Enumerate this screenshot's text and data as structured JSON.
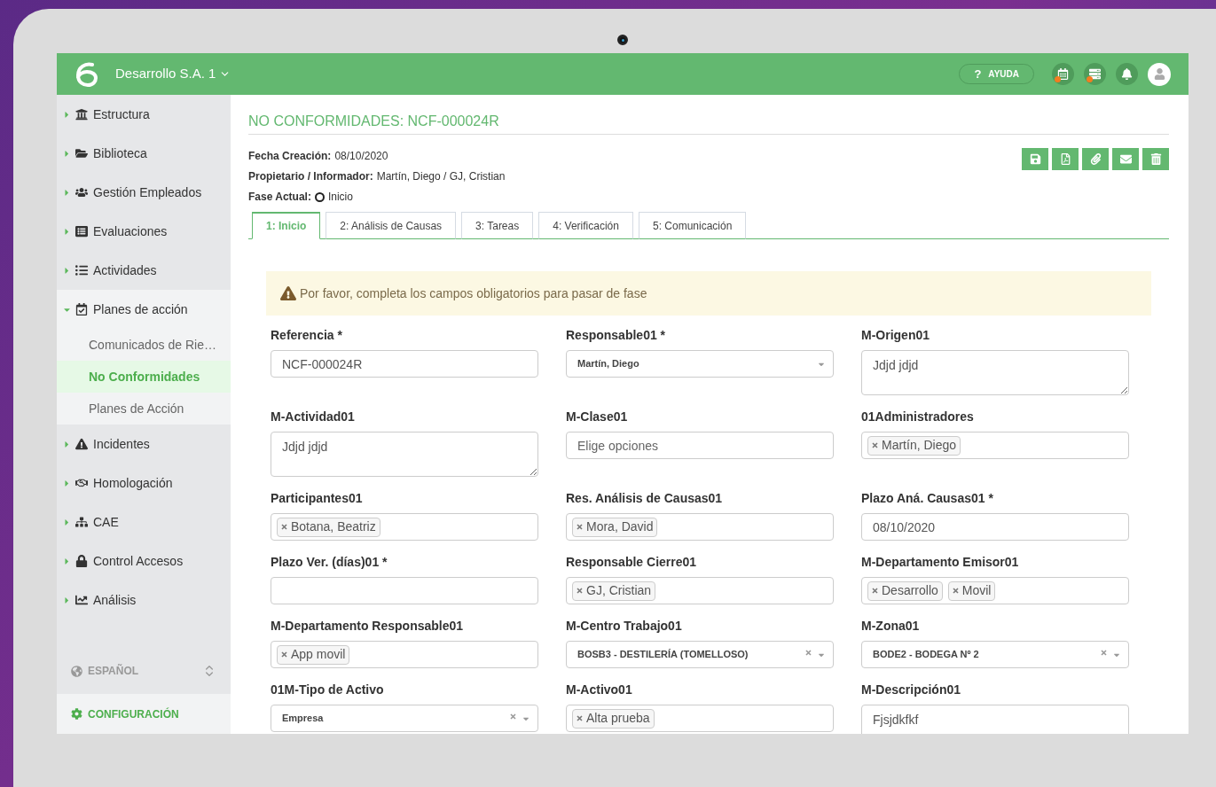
{
  "header": {
    "company": "Desarrollo S.A. 1",
    "help": "?",
    "help_label": "AYUDA",
    "icons": [
      {
        "alert": true
      },
      {
        "alert": true
      },
      {
        "alert": false
      }
    ]
  },
  "sidebar": {
    "items": [
      {
        "label": "Estructura",
        "expanded": false
      },
      {
        "label": "Biblioteca",
        "expanded": false
      },
      {
        "label": "Gestión Empleados",
        "expanded": false
      },
      {
        "label": "Evaluaciones",
        "expanded": false
      },
      {
        "label": "Actividades",
        "expanded": false
      },
      {
        "label": "Planes de acción",
        "expanded": true,
        "children": [
          {
            "label": "Comunicados de Rie…",
            "selected": false
          },
          {
            "label": "No Conformidades",
            "selected": true
          },
          {
            "label": "Planes de Acción",
            "selected": false
          }
        ]
      },
      {
        "label": "Incidentes",
        "expanded": false
      },
      {
        "label": "Homologación",
        "expanded": false
      },
      {
        "label": "CAE",
        "expanded": false
      },
      {
        "label": "Control Accesos",
        "expanded": false
      },
      {
        "label": "Análisis",
        "expanded": false
      }
    ],
    "language": "ESPAÑOL",
    "settings": "CONFIGURACIÓN"
  },
  "page": {
    "title": "NO CONFORMIDADES: NCF-000024R",
    "meta": [
      {
        "label": "Fecha Creación:",
        "value": "08/10/2020",
        "kind": "text"
      },
      {
        "label": "Propietario / Informador:",
        "value": "Martín, Diego / GJ, Cristian",
        "kind": "text"
      },
      {
        "label": "Fase Actual:",
        "value": "Inicio",
        "kind": "phase"
      }
    ],
    "tabs": [
      {
        "label": "1: Inicio",
        "selected": true
      },
      {
        "label": "2: Análisis de Causas",
        "selected": false
      },
      {
        "label": "3: Tareas",
        "selected": false
      },
      {
        "label": "4: Verificación",
        "selected": false
      },
      {
        "label": "5: Comunicación",
        "selected": false
      }
    ],
    "alert": "Por favor, completa los campos obligatorios para pasar de fase",
    "fields": [
      {
        "label": "Referencia *",
        "kind": "text",
        "value": "NCF-000024R"
      },
      {
        "label": "Responsable01 *",
        "kind": "select",
        "value": "Martín, Diego",
        "clearable": false
      },
      {
        "label": "M-Origen01",
        "kind": "textarea",
        "value": "Jdjd jdjd"
      },
      {
        "label": "M-Actividad01",
        "kind": "textarea",
        "value": "Jdjd jdjd"
      },
      {
        "label": "M-Clase01",
        "kind": "text",
        "placeholder": "Elige opciones"
      },
      {
        "label": "01Administradores",
        "kind": "tags",
        "tags": [
          "Martín, Diego"
        ]
      },
      {
        "label": "Participantes01",
        "kind": "tags",
        "tags": [
          "Botana, Beatriz"
        ]
      },
      {
        "label": "Res. Análisis de Causas01",
        "kind": "tags",
        "tags": [
          "Mora, David"
        ]
      },
      {
        "label": "Plazo Aná. Causas01 *",
        "kind": "text",
        "value": "08/10/2020"
      },
      {
        "label": "Plazo Ver. (días)01 *",
        "kind": "text"
      },
      {
        "label": "Responsable Cierre01",
        "kind": "tags",
        "tags": [
          "GJ, Cristian"
        ]
      },
      {
        "label": "M-Departamento Emisor01",
        "kind": "tags",
        "tags": [
          "Desarrollo",
          "Movil"
        ]
      },
      {
        "label": "M-Departamento Responsable01",
        "kind": "tags",
        "tags": [
          "App movil"
        ]
      },
      {
        "label": "M-Centro Trabajo01",
        "kind": "select",
        "value": "BOSB3 - DESTILERÍA (TOMELLOSO)",
        "clearable": true
      },
      {
        "label": "M-Zona01",
        "kind": "select",
        "value": "BODE2 - BODEGA Nº 2",
        "clearable": true
      },
      {
        "label": "01M-Tipo de Activo",
        "kind": "select",
        "value": "Empresa",
        "clearable": true
      },
      {
        "label": "M-Activo01",
        "kind": "tags",
        "tags": [
          "Alta prueba"
        ]
      },
      {
        "label": "M-Descripción01",
        "kind": "textarea",
        "value": "Fjsjdkfkf"
      }
    ]
  }
}
